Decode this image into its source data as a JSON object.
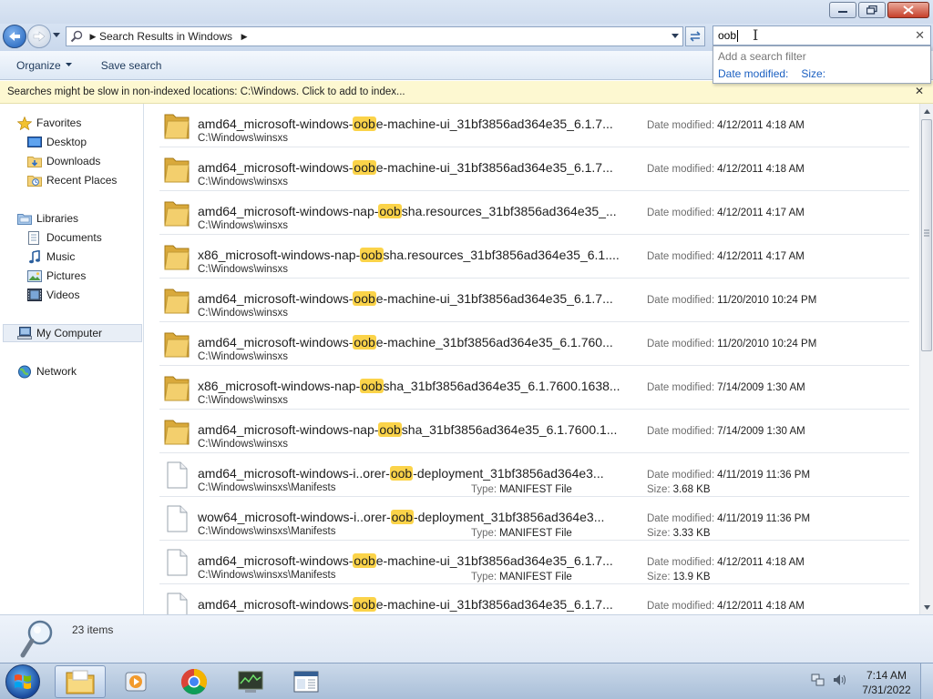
{
  "navigation": {
    "breadcrumb": "Search Results in Windows"
  },
  "search": {
    "query": "oob",
    "filter_hint": "Add a search filter",
    "filters": [
      "Date modified:",
      "Size:"
    ]
  },
  "toolbar": {
    "organize_label": "Organize",
    "save_search_label": "Save search"
  },
  "infobar": {
    "message": "Searches might be slow in non-indexed locations: C:\\Windows. Click to add to index..."
  },
  "sidebar": {
    "favorites": "Favorites",
    "desktop": "Desktop",
    "downloads": "Downloads",
    "recent_places": "Recent Places",
    "libraries": "Libraries",
    "documents": "Documents",
    "music": "Music",
    "pictures": "Pictures",
    "videos": "Videos",
    "my_computer": "My Computer",
    "network": "Network"
  },
  "results": [
    {
      "kind": "folder",
      "pre": "amd64_microsoft-windows-",
      "hl": "oob",
      "post": "e-machine-ui_31bf3856ad364e35_6.1.7...",
      "path": "C:\\Windows\\winsxs",
      "date_label": "Date modified:",
      "date": "4/12/2011 4:18 AM"
    },
    {
      "kind": "folder",
      "pre": "amd64_microsoft-windows-",
      "hl": "oob",
      "post": "e-machine-ui_31bf3856ad364e35_6.1.7...",
      "path": "C:\\Windows\\winsxs",
      "date_label": "Date modified:",
      "date": "4/12/2011 4:18 AM"
    },
    {
      "kind": "folder",
      "pre": "amd64_microsoft-windows-nap-",
      "hl": "oob",
      "post": "sha.resources_31bf3856ad364e35_...",
      "path": "C:\\Windows\\winsxs",
      "date_label": "Date modified:",
      "date": "4/12/2011 4:17 AM"
    },
    {
      "kind": "folder",
      "pre": "x86_microsoft-windows-nap-",
      "hl": "oob",
      "post": "sha.resources_31bf3856ad364e35_6.1....",
      "path": "C:\\Windows\\winsxs",
      "date_label": "Date modified:",
      "date": "4/12/2011 4:17 AM"
    },
    {
      "kind": "folder",
      "pre": "amd64_microsoft-windows-",
      "hl": "oob",
      "post": "e-machine-ui_31bf3856ad364e35_6.1.7...",
      "path": "C:\\Windows\\winsxs",
      "date_label": "Date modified:",
      "date": "11/20/2010 10:24 PM"
    },
    {
      "kind": "folder",
      "pre": "amd64_microsoft-windows-",
      "hl": "oob",
      "post": "e-machine_31bf3856ad364e35_6.1.760...",
      "path": "C:\\Windows\\winsxs",
      "date_label": "Date modified:",
      "date": "11/20/2010 10:24 PM"
    },
    {
      "kind": "folder",
      "pre": "x86_microsoft-windows-nap-",
      "hl": "oob",
      "post": "sha_31bf3856ad364e35_6.1.7600.1638...",
      "path": "C:\\Windows\\winsxs",
      "date_label": "Date modified:",
      "date": "7/14/2009 1:30 AM"
    },
    {
      "kind": "folder",
      "pre": "amd64_microsoft-windows-nap-",
      "hl": "oob",
      "post": "sha_31bf3856ad364e35_6.1.7600.1...",
      "path": "C:\\Windows\\winsxs",
      "date_label": "Date modified:",
      "date": "7/14/2009 1:30 AM"
    },
    {
      "kind": "file",
      "pre": "amd64_microsoft-windows-i..orer-",
      "hl": "oob",
      "post": "-deployment_31bf3856ad364e3...",
      "path": "C:\\Windows\\winsxs\\Manifests",
      "date_label": "Date modified:",
      "date": "4/11/2019 11:36 PM",
      "type_label": "Type:",
      "type": "MANIFEST File",
      "size_label": "Size:",
      "size": "3.68 KB"
    },
    {
      "kind": "file",
      "pre": "wow64_microsoft-windows-i..orer-",
      "hl": "oob",
      "post": "-deployment_31bf3856ad364e3...",
      "path": "C:\\Windows\\winsxs\\Manifests",
      "date_label": "Date modified:",
      "date": "4/11/2019 11:36 PM",
      "type_label": "Type:",
      "type": "MANIFEST File",
      "size_label": "Size:",
      "size": "3.33 KB"
    },
    {
      "kind": "file",
      "pre": "amd64_microsoft-windows-",
      "hl": "oob",
      "post": "e-machine-ui_31bf3856ad364e35_6.1.7...",
      "path": "C:\\Windows\\winsxs\\Manifests",
      "date_label": "Date modified:",
      "date": "4/12/2011 4:18 AM",
      "type_label": "Type:",
      "type": "MANIFEST File",
      "size_label": "Size:",
      "size": "13.9 KB"
    },
    {
      "kind": "file",
      "pre": "amd64_microsoft-windows-",
      "hl": "oob",
      "post": "e-machine-ui_31bf3856ad364e35_6.1.7...",
      "path": "",
      "date_label": "Date modified:",
      "date": "4/12/2011 4:18 AM"
    }
  ],
  "status": {
    "item_count": "23 items"
  },
  "taskbar": {
    "time": "7:14 AM",
    "date": "7/31/2022"
  },
  "colors": {
    "highlight": "#fbd349",
    "link": "#1a5fc1",
    "infobar_bg": "#fdf8d1"
  }
}
